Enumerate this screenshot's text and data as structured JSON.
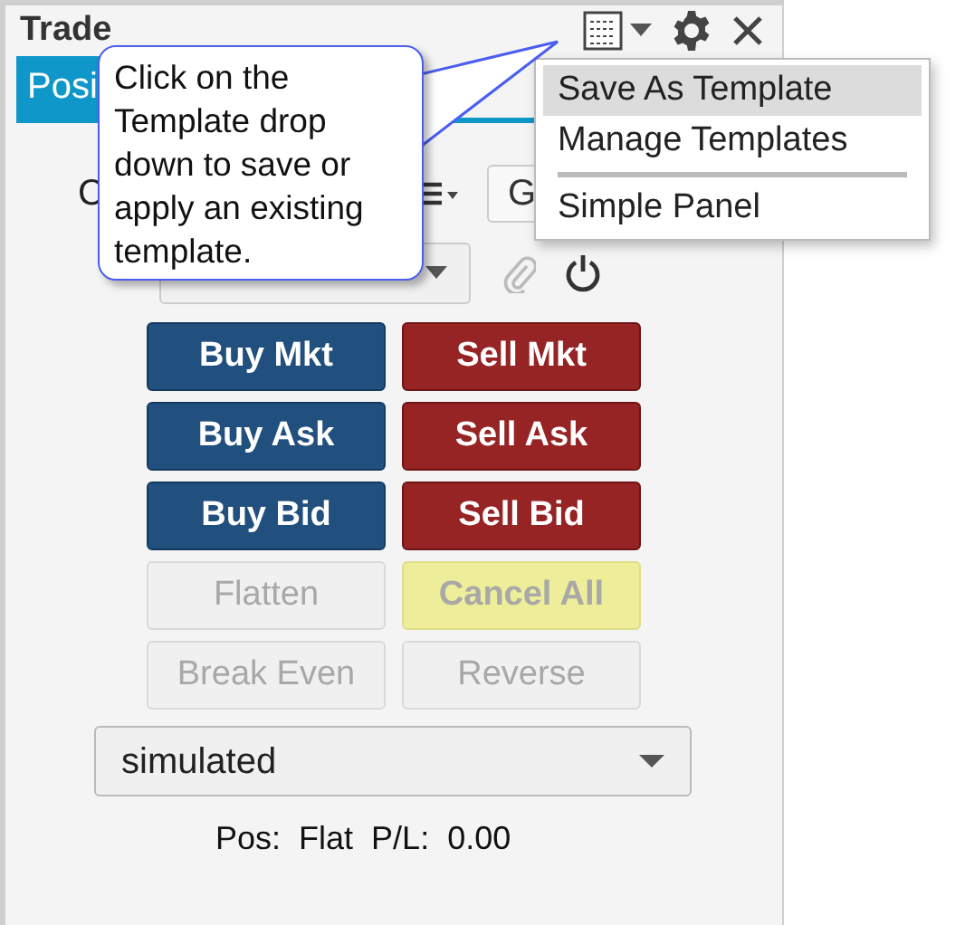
{
  "window": {
    "title": "Trade"
  },
  "tabs": [
    {
      "label": "Posi",
      "selected": true
    }
  ],
  "order_row": {
    "label": "C",
    "button": "G"
  },
  "buttons": [
    {
      "label": "Buy Mkt",
      "kind": "buy",
      "disabled": false
    },
    {
      "label": "Sell Mkt",
      "kind": "sell",
      "disabled": false
    },
    {
      "label": "Buy Ask",
      "kind": "buy",
      "disabled": false
    },
    {
      "label": "Sell Ask",
      "kind": "sell",
      "disabled": false
    },
    {
      "label": "Buy Bid",
      "kind": "buy",
      "disabled": false
    },
    {
      "label": "Sell Bid",
      "kind": "sell",
      "disabled": false
    },
    {
      "label": "Flatten",
      "kind": "plain",
      "disabled": true
    },
    {
      "label": "Cancel All",
      "kind": "cancel",
      "disabled": true
    },
    {
      "label": "Break Even",
      "kind": "plain",
      "disabled": true
    },
    {
      "label": "Reverse",
      "kind": "plain",
      "disabled": true
    }
  ],
  "account": {
    "value": "simulated"
  },
  "status": {
    "pos_label": "Pos:",
    "pos_value": "Flat",
    "pl_label": "P/L:",
    "pl_value": "0.00"
  },
  "menu": [
    {
      "label": "Save As Template",
      "selected": true
    },
    {
      "label": "Manage Templates",
      "selected": false
    },
    {
      "label": "Simple Panel",
      "selected": false
    }
  ],
  "callout": {
    "text": "Click on the Template drop down to save or apply an existing template."
  }
}
